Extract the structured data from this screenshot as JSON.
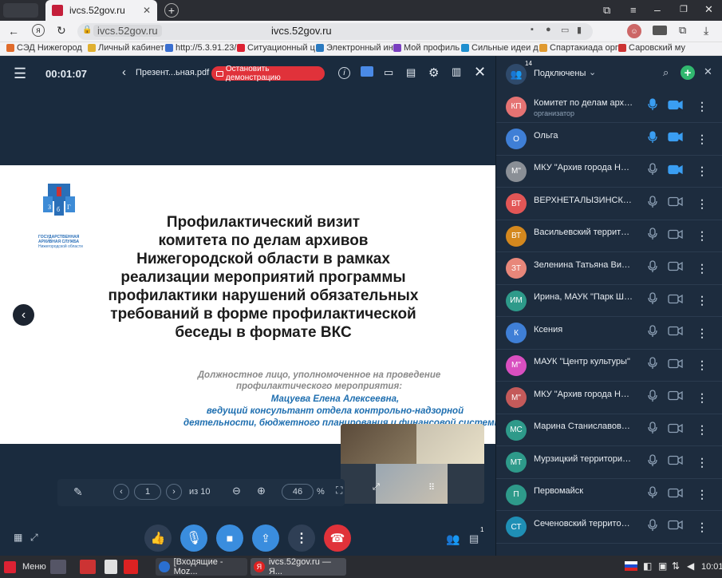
{
  "browser": {
    "tab_title": "ivcs.52gov.ru",
    "address_chip": "ivcs.52gov.ru",
    "page_title_center": "ivcs.52gov.ru",
    "bookmarks": [
      "СЭД Нижегород",
      "Личный кабинет",
      "http://5.3.91.23/",
      "Ситуационный ц",
      "Электронный ин",
      "Мой профиль",
      "Сильные идеи д",
      "Спартакиада орг",
      "Саровский му"
    ]
  },
  "toolbar": {
    "timer": "00:01:07",
    "file_name": "Презент...ьная.pdf",
    "stop_demo_label": "Остановить демонстрацию"
  },
  "slide": {
    "logo_caption_line1": "ГОСУДАРСТВЕННАЯ",
    "logo_caption_line2": "АРХИВНАЯ СЛУЖБА",
    "logo_caption_line3": "Нижегородской области",
    "title_lines": [
      "Профилактический визит",
      "комитета по делам архивов",
      "Нижегородской области в рамках",
      "реализации мероприятий программы",
      "профилактики нарушений обязательных",
      "требований  в форме профилактической",
      "беседы в формате ВКС"
    ],
    "subtitle_lines": [
      "Должностное лицо, уполномоченное на проведение",
      "профилактического мероприятия:"
    ],
    "blue_lines": [
      "Мацуева Елена Алексеевна,",
      "ведущий консультант отдела контрольно-надзорной",
      "деятельности, бюджетного планирования и финансовой системы"
    ]
  },
  "pager": {
    "page": "1",
    "of_label": "из 10",
    "zoom": "46",
    "zoom_unit": "%"
  },
  "panel": {
    "count": "14",
    "title": "Подключены",
    "participants": [
      {
        "initials": "КП",
        "name": "Комитет по делам архи...",
        "role": "организатор",
        "color": "#e57373",
        "mic": "on",
        "cam": "on"
      },
      {
        "initials": "О",
        "name": "Ольга",
        "role": "",
        "color": "#3f7fd6",
        "mic": "on",
        "cam": "on"
      },
      {
        "initials": "М\"",
        "name": "МКУ \"Архив города Ниж...",
        "role": "",
        "color": "#8a8f96",
        "mic": "off",
        "cam": "on"
      },
      {
        "initials": "ВТ",
        "name": "ВЕРХНЕТАЛЫЗИНСКИЙ ...",
        "role": "",
        "color": "#e25656",
        "mic": "off",
        "cam": "off"
      },
      {
        "initials": "ВТ",
        "name": "Васильевский территор...",
        "role": "",
        "color": "#d4881e",
        "mic": "off",
        "cam": "off"
      },
      {
        "initials": "ЗТ",
        "name": "Зеленина Татьяна Викт...",
        "role": "",
        "color": "#e8877a",
        "mic": "off",
        "cam": "off"
      },
      {
        "initials": "ИМ",
        "name": "Ирина, МАУК \"Парк Шв...",
        "role": "",
        "color": "#2e9a8a",
        "mic": "off",
        "cam": "off"
      },
      {
        "initials": "К",
        "name": "Ксения",
        "role": "",
        "color": "#3f7fd6",
        "mic": "off",
        "cam": "off"
      },
      {
        "initials": "М\"",
        "name": "МАУК \"Центр культуры\"",
        "role": "",
        "color": "#d94fc0",
        "mic": "off",
        "cam": "off"
      },
      {
        "initials": "М\"",
        "name": "МКУ \"Архив города Ниж...",
        "role": "",
        "color": "#c45a5a",
        "mic": "off",
        "cam": "off"
      },
      {
        "initials": "МС",
        "name": "Марина Станиславовна ...",
        "role": "",
        "color": "#2e9a8a",
        "mic": "off",
        "cam": "off"
      },
      {
        "initials": "МТ",
        "name": "Мурзицкий территориа...",
        "role": "",
        "color": "#2e9a8a",
        "mic": "off",
        "cam": "off"
      },
      {
        "initials": "П",
        "name": "Первомайск",
        "role": "",
        "color": "#2e9a8a",
        "mic": "off",
        "cam": "off"
      },
      {
        "initials": "СТ",
        "name": "Сеченовский территори...",
        "role": "",
        "color": "#1f8fb5",
        "mic": "off",
        "cam": "off"
      }
    ]
  },
  "bottom": {
    "chat_badge": "1"
  },
  "taskbar": {
    "menu_label": "Меню",
    "task1": "[Входящие - Moz...",
    "task2": "ivcs.52gov.ru — Я...",
    "clock": "10:01"
  },
  "icons": {
    "accent_green": "#31b86f",
    "end_call": "#e0323a",
    "stop_demo": "#e0323a"
  }
}
